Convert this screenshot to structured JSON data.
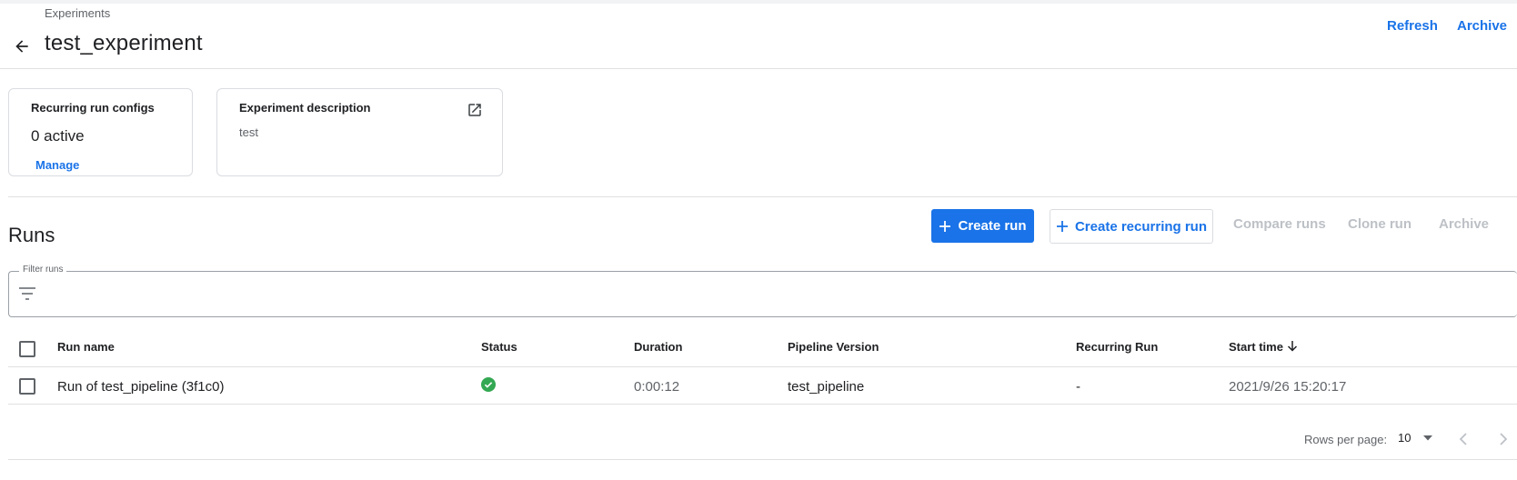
{
  "header": {
    "breadcrumb": "Experiments",
    "title": "test_experiment",
    "actions": {
      "refresh": "Refresh",
      "archive": "Archive"
    }
  },
  "cards": {
    "recurring": {
      "title": "Recurring run configs",
      "value": "0 active",
      "link": "Manage"
    },
    "description": {
      "title": "Experiment description",
      "text": "test"
    }
  },
  "runs": {
    "title": "Runs",
    "toolbar": {
      "create_run": "Create run",
      "create_recurring_run": "Create recurring run",
      "compare_runs": "Compare runs",
      "clone_run": "Clone run",
      "archive": "Archive"
    },
    "filter": {
      "label": "Filter runs",
      "value": ""
    },
    "columns": {
      "run_name": "Run name",
      "status": "Status",
      "duration": "Duration",
      "pipeline_version": "Pipeline Version",
      "recurring_run": "Recurring Run",
      "start_time": "Start time"
    },
    "rows": [
      {
        "run_name": "Run of test_pipeline (3f1c0)",
        "status": "succeeded",
        "duration": "0:00:12",
        "pipeline_version": "test_pipeline",
        "recurring_run": "-",
        "start_time": "2021/9/26 15:20:17"
      }
    ],
    "pagination": {
      "rows_per_page_label": "Rows per page:",
      "rows_per_page": "10"
    }
  },
  "colors": {
    "accent": "#1a73e8",
    "success": "#34a853",
    "disabled": "#bdc1c6",
    "border": "#dadce0"
  },
  "icons": {
    "back": "arrow-left-icon",
    "expand": "open-in-new-icon",
    "add": "plus-icon",
    "filter": "filter-list-icon",
    "sort": "arrow-down-icon",
    "status": "check-circle-icon",
    "dropdown": "caret-down-icon",
    "prev": "chevron-left-icon",
    "next": "chevron-right-icon"
  }
}
